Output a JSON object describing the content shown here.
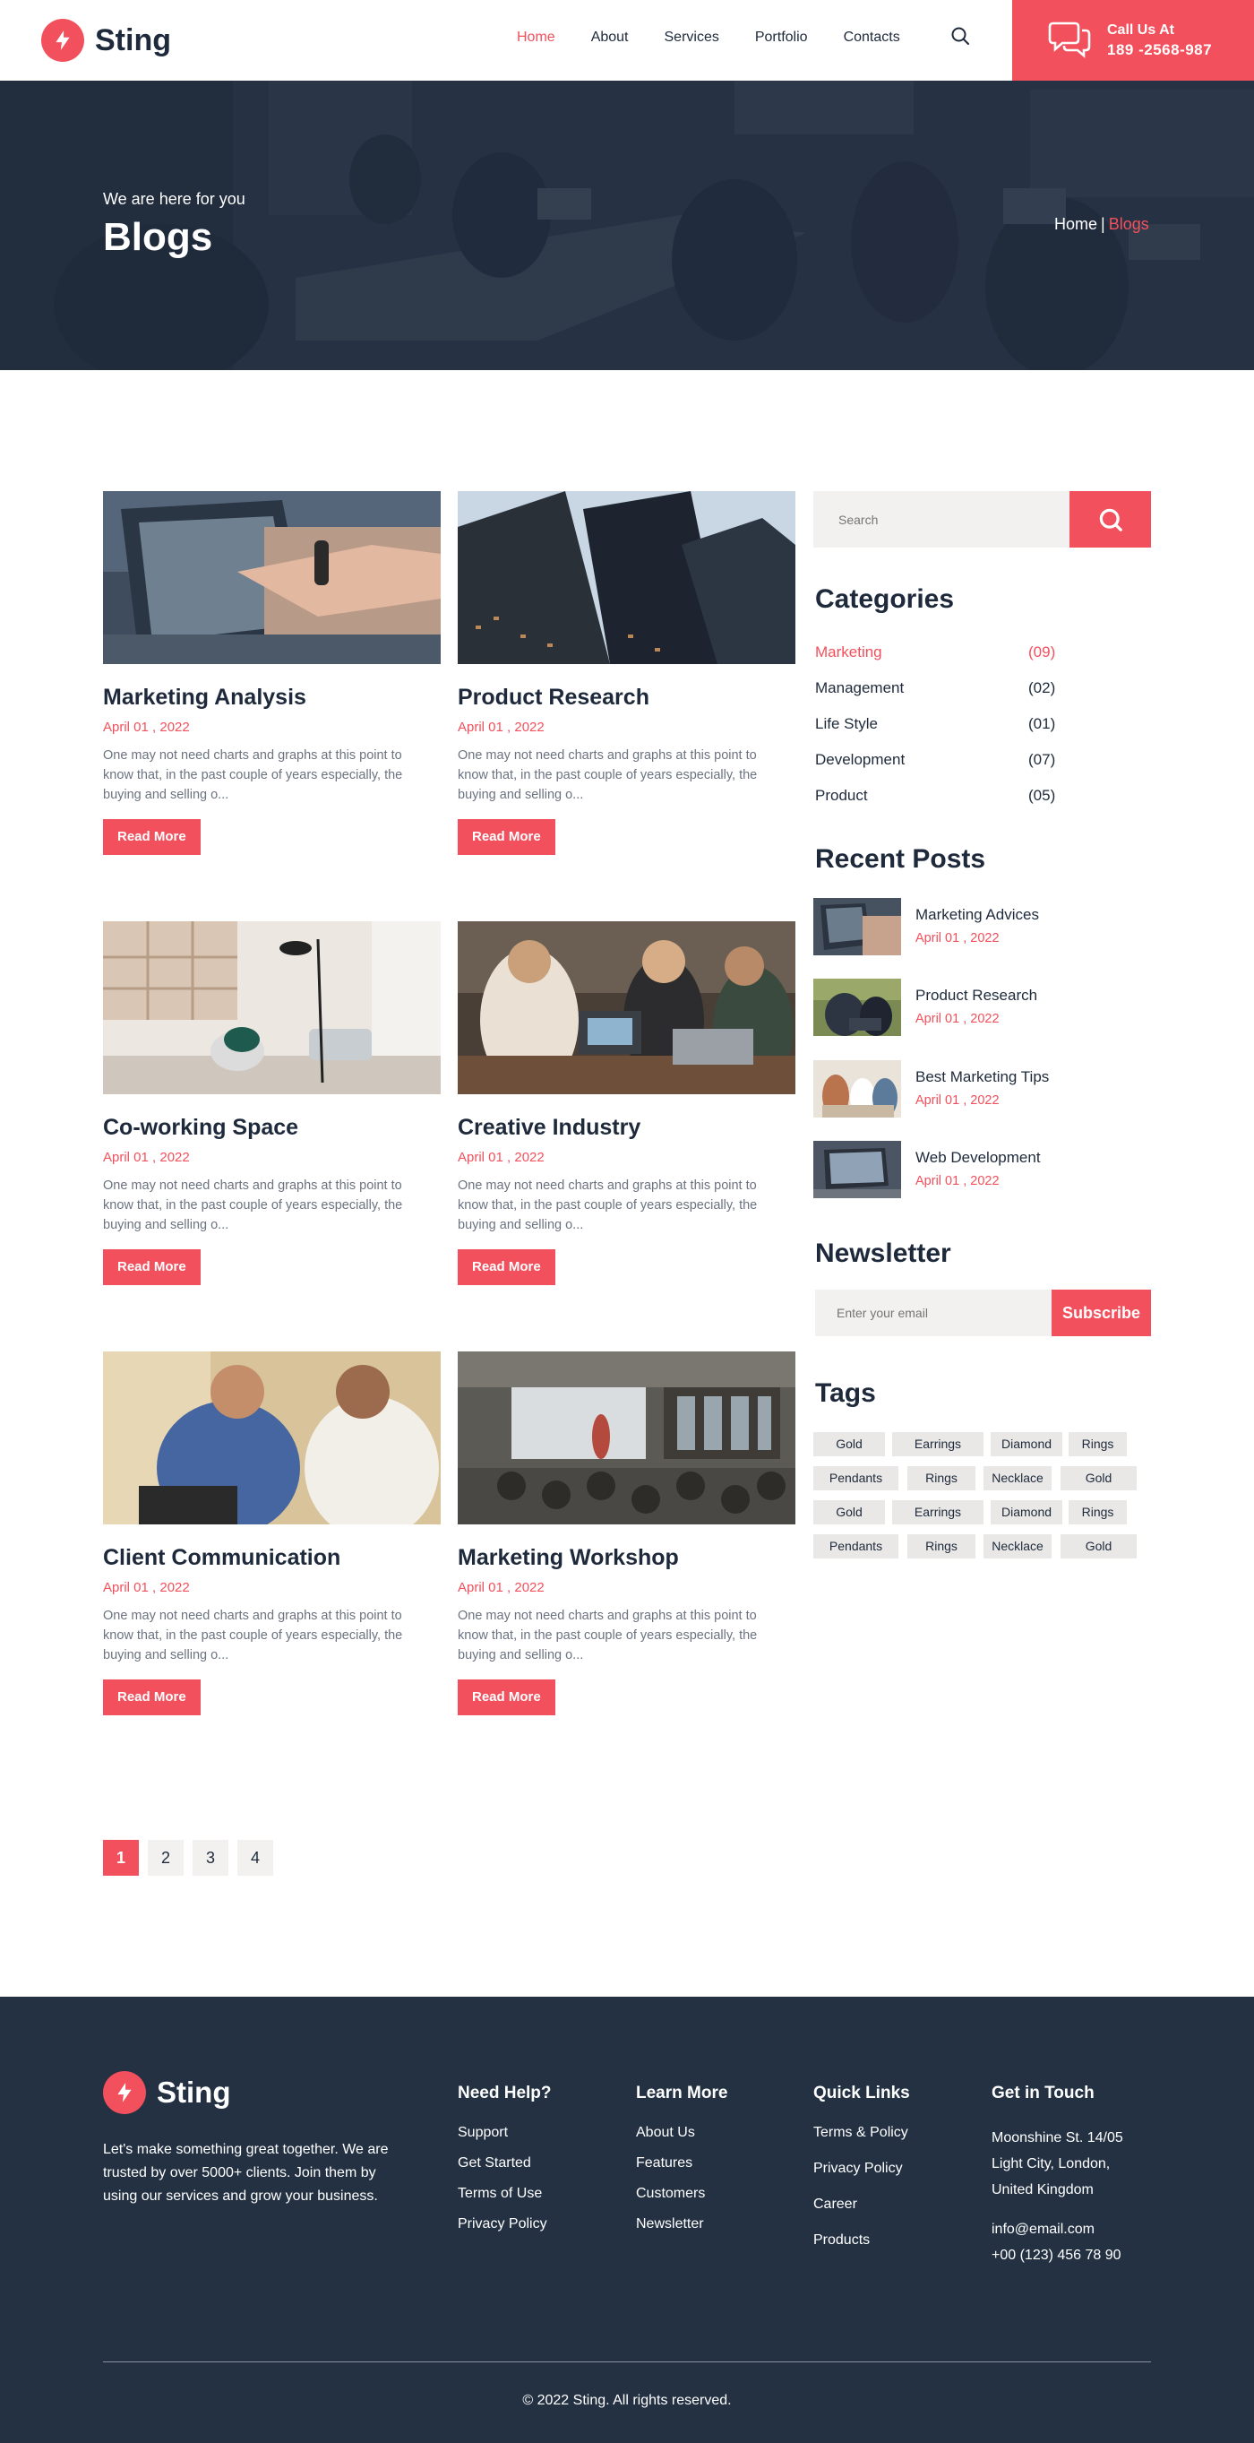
{
  "brand": {
    "name": "Sting",
    "accent": "#f2505c",
    "dark": "#1e2a3b"
  },
  "nav": {
    "items": [
      "Home",
      "About",
      "Services",
      "Portfolio",
      "Contacts"
    ],
    "active": "Home"
  },
  "call": {
    "label": "Call Us At",
    "number": "189 -2568-987"
  },
  "hero": {
    "subtitle": "We are here for you",
    "title": "Blogs",
    "breadcrumb_home": "Home",
    "breadcrumb_sep": "|",
    "breadcrumb_current": "Blogs"
  },
  "posts": [
    {
      "title": "Marketing Analysis",
      "date": "April 01 , 2022",
      "excerpt": "One may not need charts and graphs at this point to know that, in the past couple of years especially, the buying and selling o...",
      "button": "Read More"
    },
    {
      "title": "Product Research",
      "date": "April 01 , 2022",
      "excerpt": "One may not need charts and graphs at this point to know that, in the past couple of years especially, the buying and selling o...",
      "button": "Read More"
    },
    {
      "title": "Co-working Space",
      "date": "April 01 , 2022",
      "excerpt": "One may not need charts and graphs at this point to know that, in the past couple of years especially, the buying and selling o...",
      "button": "Read More"
    },
    {
      "title": "Creative Industry",
      "date": "April 01 , 2022",
      "excerpt": "One may not need charts and graphs at this point to know that, in the past couple of years especially, the buying and selling o...",
      "button": "Read More"
    },
    {
      "title": "Client Communication",
      "date": "April 01 , 2022",
      "excerpt": "One may not need charts and graphs at this point to know that, in the past couple of years especially, the buying and selling o...",
      "button": "Read More"
    },
    {
      "title": "Marketing Workshop",
      "date": "April 01 , 2022",
      "excerpt": "One may not need charts and graphs at this point to know that, in the past couple of years especially, the buying and selling o...",
      "button": "Read More"
    }
  ],
  "sidebar": {
    "search_placeholder": "Search",
    "categories_title": "Categories",
    "categories": [
      {
        "name": "Marketing",
        "count": "(09)"
      },
      {
        "name": "Management",
        "count": "(02)"
      },
      {
        "name": "Life Style",
        "count": "(01)"
      },
      {
        "name": "Development",
        "count": "(07)"
      },
      {
        "name": "Product",
        "count": "(05)"
      }
    ],
    "recent_title": "Recent Posts",
    "recent": [
      {
        "title": "Marketing Advices",
        "date": "April 01 , 2022"
      },
      {
        "title": "Product Research",
        "date": "April 01 , 2022"
      },
      {
        "title": "Best Marketing Tips",
        "date": "April 01 , 2022"
      },
      {
        "title": "Web Development",
        "date": "April 01 , 2022"
      }
    ],
    "newsletter_title": "Newsletter",
    "newsletter_placeholder": "Enter your email",
    "newsletter_button": "Subscribe",
    "tags_title": "Tags",
    "tags": [
      "Gold",
      "Earrings",
      "Diamond",
      "Rings",
      "Pendants",
      "Rings",
      "Necklace",
      "Gold",
      "Gold",
      "Earrings",
      "Diamond",
      "Rings",
      "Pendants",
      "Rings",
      "Necklace",
      "Gold"
    ]
  },
  "pagination": [
    "1",
    "2",
    "3",
    "4"
  ],
  "footer": {
    "about": "Let's make something great together. We are trusted by over 5000+ clients. Join them by using our services and grow your business.",
    "need_help": {
      "title": "Need Help?",
      "links": [
        "Support",
        "Get Started",
        "Terms of Use",
        "Privacy Policy"
      ]
    },
    "learn_more": {
      "title": "Learn More",
      "links": [
        "About Us",
        "Features",
        "Customers",
        "Newsletter"
      ]
    },
    "quick_links": {
      "title": "Quick Links",
      "links": [
        "Terms & Policy",
        "Privacy Policy",
        "Career",
        "Products"
      ]
    },
    "contact": {
      "title": "Get in Touch",
      "address_1": "Moonshine St. 14/05",
      "address_2": "Light City, London,",
      "address_3": "United Kingdom",
      "email": "info@email.com",
      "phone": "+00 (123) 456 78 90"
    },
    "copyright": "© 2022 Sting. All rights reserved."
  }
}
